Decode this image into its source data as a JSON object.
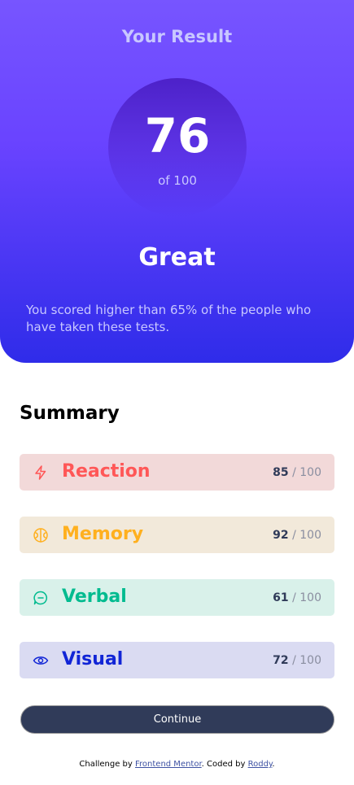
{
  "result": {
    "title": "Your Result",
    "score": "76",
    "of_label": "of 100",
    "grade": "Great",
    "message": "You scored higher than 65% of the people who have taken these tests."
  },
  "summary": {
    "title": "Summary",
    "items": [
      {
        "label": "Reaction",
        "score": "85",
        "max": "/ 100",
        "icon": "lightning-icon",
        "color": "#ff5757",
        "bg": "#f2d9d9"
      },
      {
        "label": "Memory",
        "score": "92",
        "max": "/ 100",
        "icon": "brain-icon",
        "color": "#ffb01f",
        "bg": "#f2e9da"
      },
      {
        "label": "Verbal",
        "score": "61",
        "max": "/ 100",
        "icon": "chat-icon",
        "color": "#00bb8f",
        "bg": "#d9f1ea"
      },
      {
        "label": "Visual",
        "score": "72",
        "max": "/ 100",
        "icon": "eye-icon",
        "color": "#1125d6",
        "bg": "#dadbf2"
      }
    ]
  },
  "continue_label": "Continue",
  "attribution": {
    "prefix": "Challenge by ",
    "link1": "Frontend Mentor",
    "middle": ". Coded by ",
    "link2": "Roddy",
    "suffix": "."
  }
}
